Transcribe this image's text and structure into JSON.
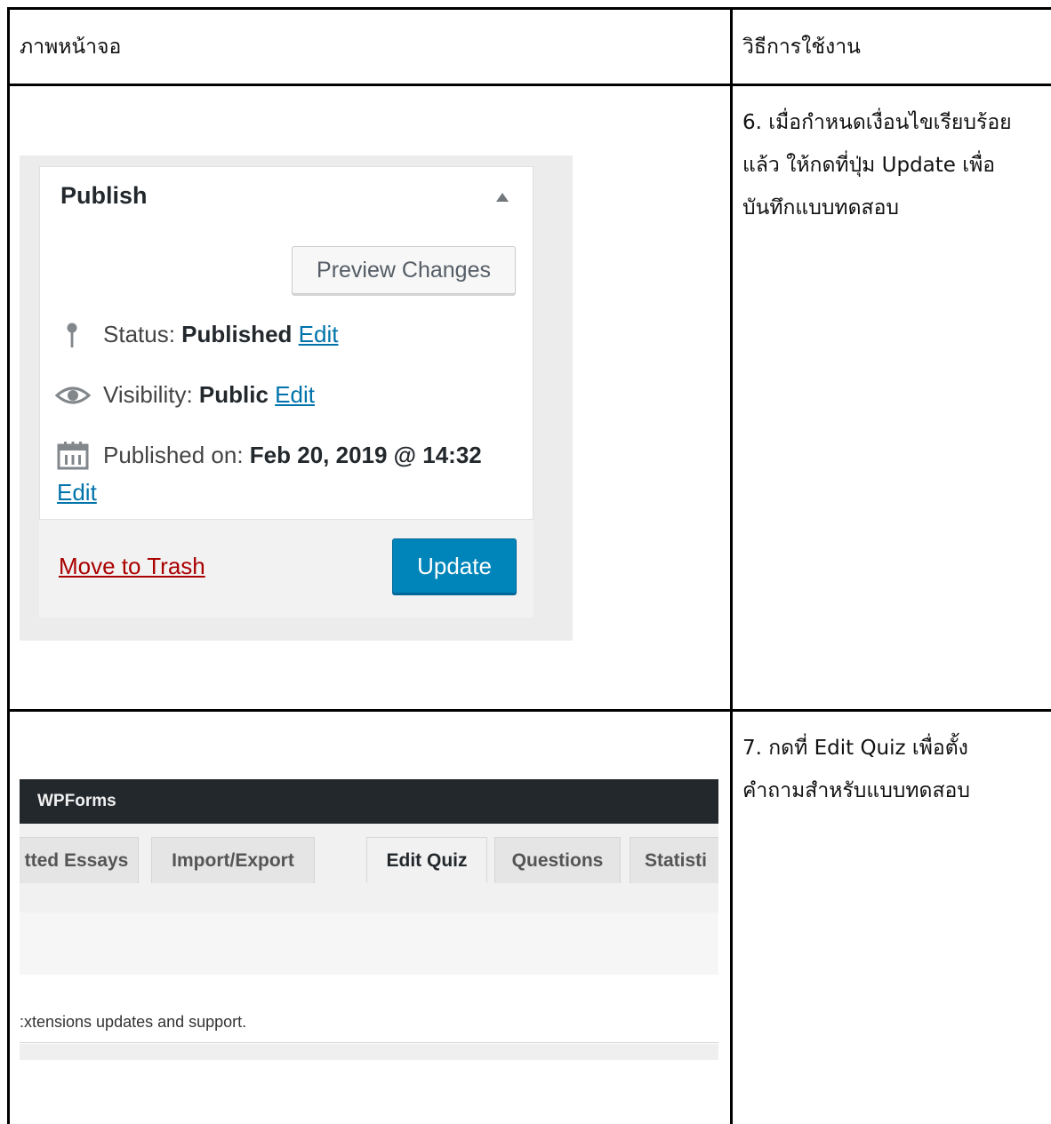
{
  "table": {
    "header": {
      "col1": "ภาพหน้าจอ",
      "col2": "วิธีการใช้งาน"
    },
    "rows": [
      {
        "instruction": "6. เมื่อกำหนดเงื่อนไขเรียบร้อย\nแล้ว ให้กดที่ปุ่ม Update เพื่อ\nบันทึกแบบทดสอบ"
      },
      {
        "instruction": "7. กดที่ Edit Quiz เพื่อตั้ง\nคำถามสำหรับแบบทดสอบ"
      }
    ]
  },
  "publish_box": {
    "title": "Publish",
    "preview_button": "Preview Changes",
    "status_label": "Status:",
    "status_value": "Published",
    "visibility_label": "Visibility:",
    "visibility_value": "Public",
    "published_label": "Published on:",
    "published_value": "Feb 20, 2019 @ 14:32",
    "edit_link": "Edit",
    "trash_link": "Move to Trash",
    "update_button": "Update",
    "colors": {
      "primary": "#0085ba",
      "link": "#0073aa",
      "danger": "#a00"
    },
    "icons": {
      "status": "pin-icon",
      "visibility": "eye-icon",
      "date": "calendar-icon",
      "toggle": "caret-up-icon"
    }
  },
  "wpforms": {
    "topbar_label": "WPForms",
    "tabs": [
      {
        "label": "tted Essays"
      },
      {
        "label": "Import/Export"
      },
      {
        "label": "Edit Quiz"
      },
      {
        "label": "Questions"
      },
      {
        "label": "Statisti"
      }
    ],
    "active_tab": "Edit Quiz",
    "notice_text": ":xtensions updates and support."
  }
}
